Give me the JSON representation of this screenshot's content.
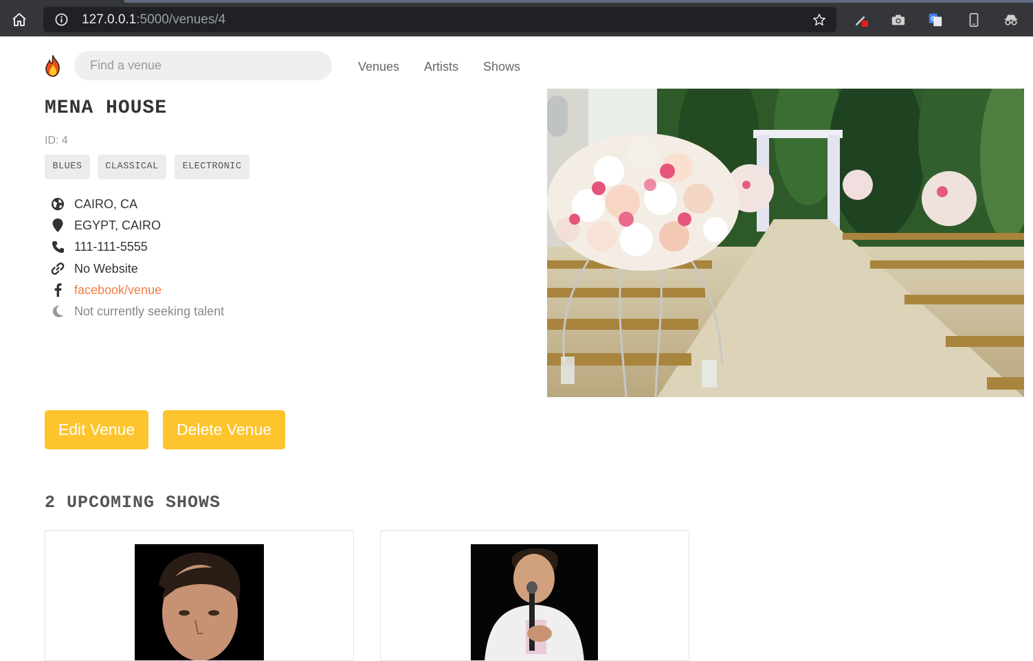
{
  "browser": {
    "url_host": "127.0.0.1",
    "url_path": ":5000/venues/4",
    "icons": [
      "home-icon",
      "info-icon",
      "bookmark-star-icon",
      "pen-extension-icon",
      "camera-extension-icon",
      "translate-extension-icon",
      "phone-extension-icon",
      "incognito-extension-icon"
    ]
  },
  "nav": {
    "search_placeholder": "Find a venue",
    "links": [
      "Venues",
      "Artists",
      "Shows"
    ],
    "logo_icon": "fire-icon"
  },
  "venue": {
    "name": "MENA HOUSE",
    "id_label": "ID: 4",
    "genres": [
      "BLUES",
      "CLASSICAL",
      "ELECTRONIC"
    ],
    "city_state": "CAIRO, CA",
    "address": "EGYPT, CAIRO",
    "phone": "111-111-5555",
    "website": "No Website",
    "facebook": "facebook/venue",
    "seeking": "Not currently seeking talent"
  },
  "actions": {
    "edit_label": "Edit Venue",
    "delete_label": "Delete Venue"
  },
  "shows": {
    "heading": "2 UPCOMING SHOWS"
  },
  "colors": {
    "accent_button": "#fdc42d",
    "link_orange": "#f47c46",
    "chrome_dark": "#35363a"
  }
}
